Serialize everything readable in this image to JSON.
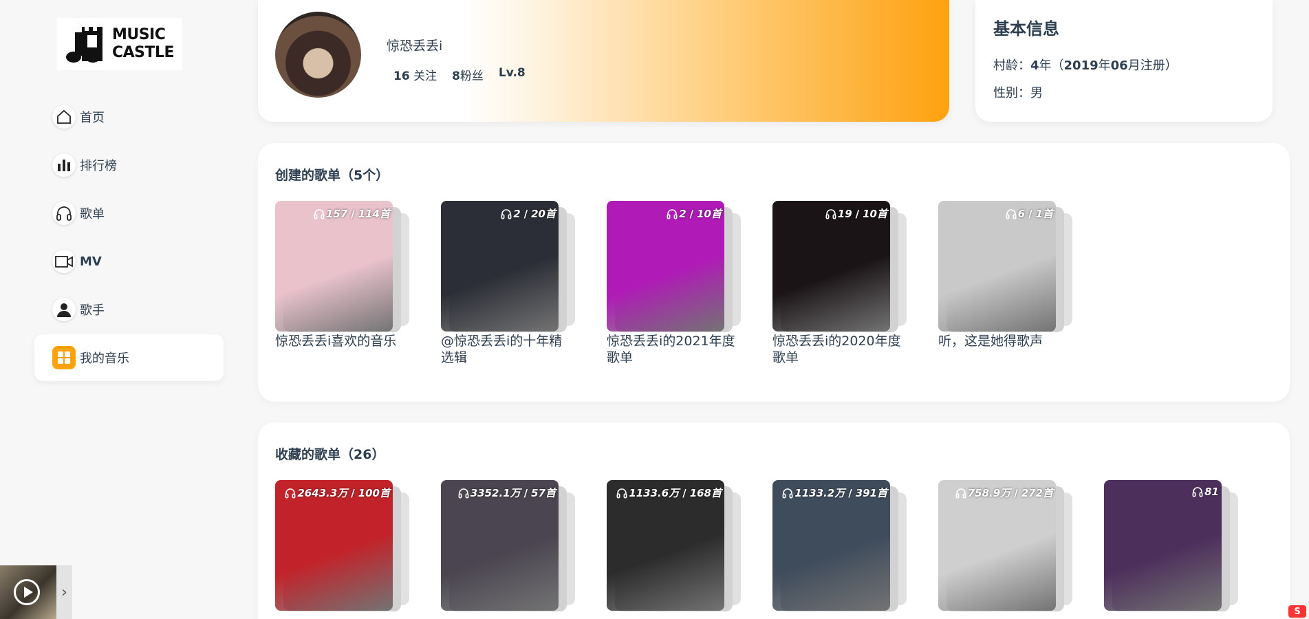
{
  "logo": {
    "line1": "MUSIC",
    "line2": "CASTLE"
  },
  "nav": [
    {
      "label": "首页",
      "icon": "home-icon",
      "active": false
    },
    {
      "label": "排行榜",
      "icon": "bar-chart-icon",
      "active": false
    },
    {
      "label": "歌单",
      "icon": "headphones-icon",
      "active": false
    },
    {
      "label": "MV",
      "icon": "video-camera-icon",
      "active": false
    },
    {
      "label": "歌手",
      "icon": "person-icon",
      "active": false
    },
    {
      "label": "我的音乐",
      "icon": "grid-icon",
      "active": true
    }
  ],
  "profile": {
    "username": "惊恐丢丢i",
    "follow_count": "16",
    "follow_label": "关注",
    "fans_count": "8",
    "fans_label": "粉丝",
    "level": "Lv.8"
  },
  "info": {
    "title": "基本信息",
    "age_label": "村龄：",
    "age_value": "4",
    "age_unit": "年（",
    "reg_year": "2019",
    "reg_year_unit": "年",
    "reg_month": "06",
    "reg_suffix": "月注册）",
    "gender_label": "性别：",
    "gender_value": "男"
  },
  "created": {
    "title": "创建的歌单（5个）",
    "playlists": [
      {
        "plays": "157",
        "tracks": "114首",
        "name": "惊恐丢丢i喜欢的音乐",
        "cover": "#e9c2cc"
      },
      {
        "plays": "2",
        "tracks": "20首",
        "name": "@惊恐丢丢i的十年精选辑",
        "cover": "#2b2e36"
      },
      {
        "plays": "2",
        "tracks": "10首",
        "name": "惊恐丢丢i的2021年度歌单",
        "cover": "#b01ab7"
      },
      {
        "plays": "19",
        "tracks": "10首",
        "name": "惊恐丢丢i的2020年度歌单",
        "cover": "#1a1416"
      },
      {
        "plays": "6",
        "tracks": "1首",
        "name": "听，这是她得歌声",
        "cover": "#c9c9c9"
      }
    ]
  },
  "favorites": {
    "title": "收藏的歌单（26）",
    "playlists": [
      {
        "plays": "2643.3万",
        "tracks": "100首",
        "cover": "#c2232a"
      },
      {
        "plays": "3352.1万",
        "tracks": "57首",
        "cover": "#4a4550"
      },
      {
        "plays": "1133.6万",
        "tracks": "168首",
        "cover": "#2c2c2c"
      },
      {
        "plays": "1133.2万",
        "tracks": "391首",
        "cover": "#3f4c5c"
      },
      {
        "plays": "758.9万",
        "tracks": "272首",
        "cover": "#cfcfcf"
      },
      {
        "plays": "81",
        "tracks": "",
        "cover": "#4d2f5c"
      }
    ]
  },
  "mini_player": {
    "toggle": "›"
  },
  "watermark": "S"
}
